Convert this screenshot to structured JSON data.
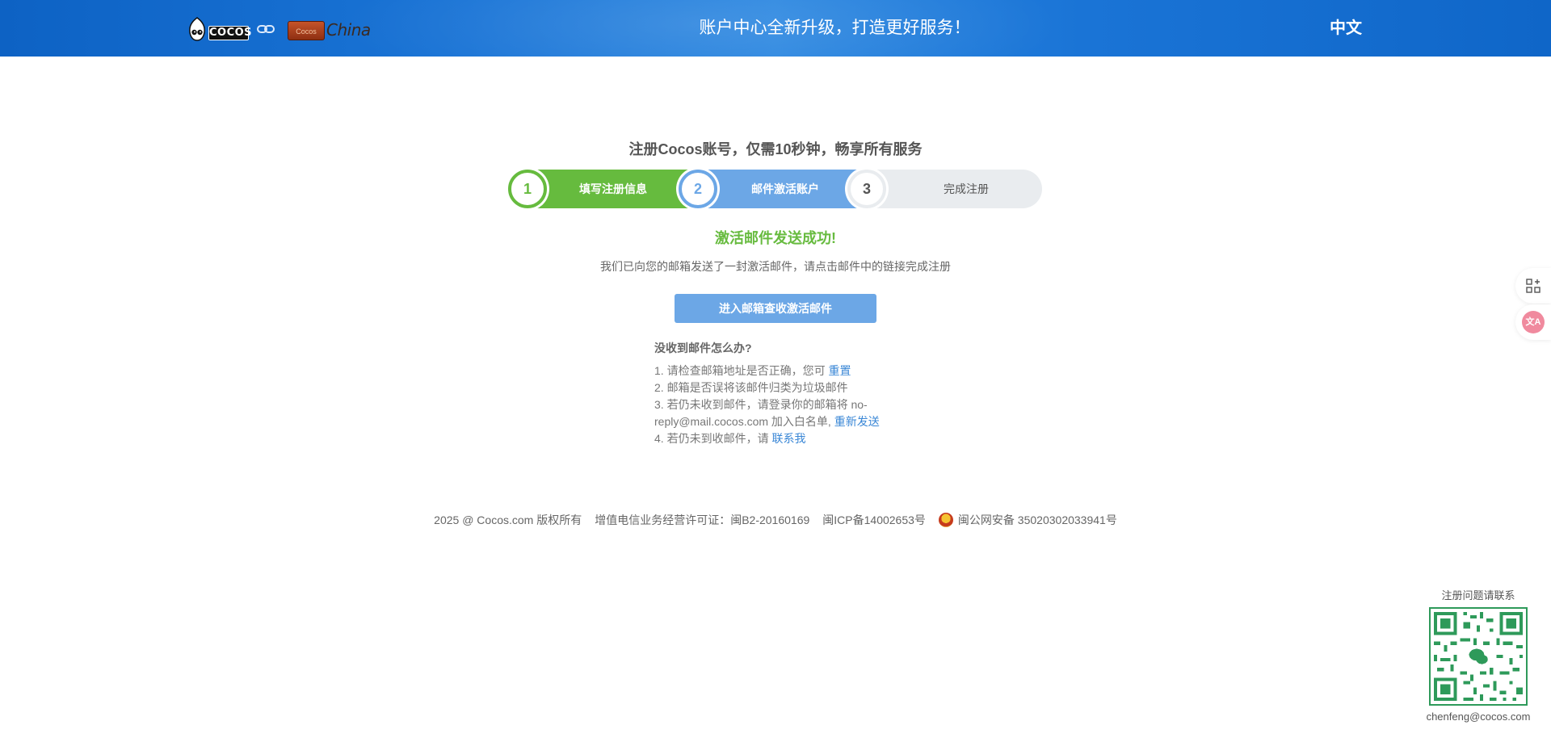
{
  "header": {
    "logo_cocos_text": "COCOS",
    "logo_china_badge": "Cocos",
    "logo_china_text": "China",
    "announcement": "账户中心全新升级，打造更好服务！",
    "language": "中文"
  },
  "register": {
    "title": "注册Cocos账号，仅需10秒钟，畅享所有服务",
    "steps": [
      {
        "number": "1",
        "label": "填写注册信息"
      },
      {
        "number": "2",
        "label": "邮件激活账户"
      },
      {
        "number": "3",
        "label": "完成注册"
      }
    ],
    "success_title": "激活邮件发送成功!",
    "success_desc": "我们已向您的邮箱发送了一封激活邮件，请点击邮件中的链接完成注册",
    "go_mail_button": "进入邮箱查收激活邮件"
  },
  "help": {
    "question": "没收到邮件怎么办?",
    "item1_text": "1. 请检查邮箱地址是否正确，您可",
    "item1_link": "重置",
    "item2_text": "2. 邮箱是否误将该邮件归类为垃圾邮件",
    "item3_text": "3. 若仍未收到邮件，请登录你的邮箱将 no-reply@mail.cocos.com 加入白名单,",
    "item3_link": "重新发送",
    "item4_text": "4. 若仍未到收邮件，请",
    "item4_link": "联系我"
  },
  "footer": {
    "copyright": "2025 @ Cocos.com 版权所有",
    "license": "增值电信业务经营许可证：闽B2-20160169",
    "icp": "闽ICP备14002653号",
    "police": "闽公网安备 35020302033941号"
  },
  "contact": {
    "title": "注册问题请联系",
    "email": "chenfeng@cocos.com"
  },
  "side_tools": {
    "tool1_icon": "apps-add-icon",
    "tool2_icon": "translate-icon",
    "tool2_text": "文A"
  },
  "colors": {
    "header_blue": "#1a6fd3",
    "step_green": "#66bb3e",
    "step_blue": "#6ca7e6",
    "step_gray": "#e9ecef",
    "link_blue": "#3a87d6"
  }
}
